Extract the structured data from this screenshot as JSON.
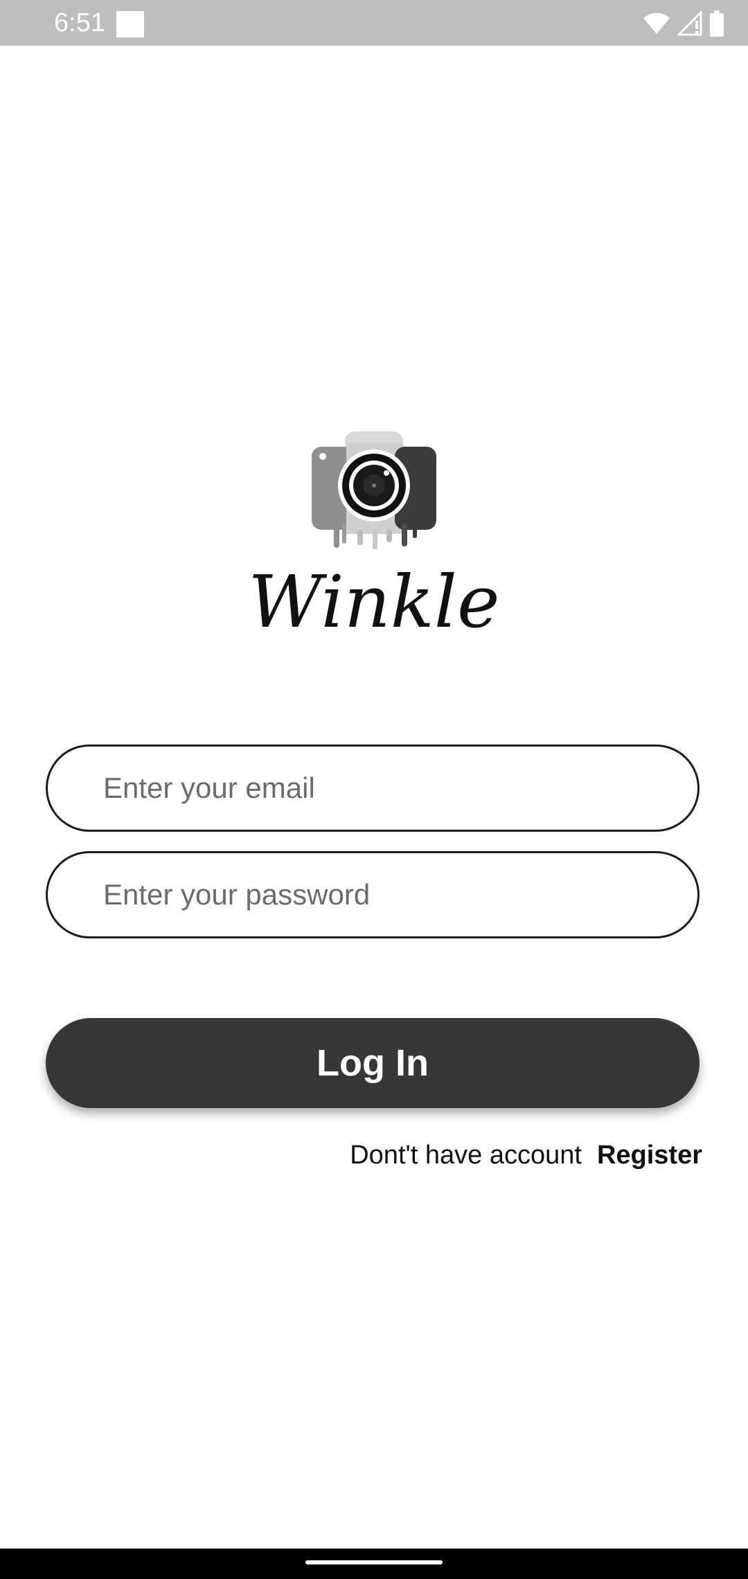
{
  "status_bar": {
    "time": "6:51",
    "icons": [
      "notification-square-icon",
      "wifi-icon",
      "signal-icon",
      "battery-icon"
    ]
  },
  "brand": {
    "logo_icon": "camera-icon",
    "name": "Winkle"
  },
  "form": {
    "email_placeholder": "Enter your email",
    "email_value": "",
    "password_placeholder": "Enter your password",
    "password_value": ""
  },
  "login_button": {
    "label": "Log In",
    "color": "#363636"
  },
  "register": {
    "prompt": "Dont't have account",
    "link_label": "Register"
  }
}
